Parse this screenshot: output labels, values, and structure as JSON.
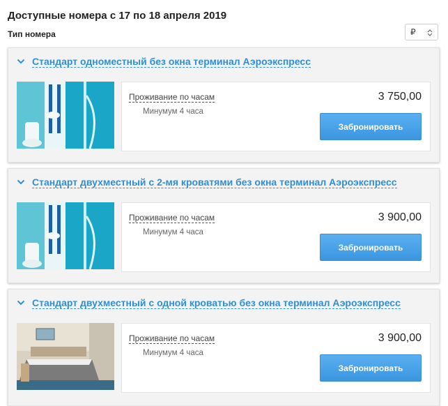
{
  "page_title": "Доступные номера с 17 по 18 апреля 2019",
  "room_type_label": "Тип номера",
  "currency": {
    "selected": "₽"
  },
  "rooms": [
    {
      "name": "Стандарт одноместный без окна терминал Аэроэкспресс",
      "tariff": "Проживание по часам",
      "minimum": "Минумум 4 часа",
      "price": "3 750,00",
      "book_label": "Забронировать"
    },
    {
      "name": "Стандарт двухместный с 2-мя кроватями без окна терминал Аэроэкспресс",
      "tariff": "Проживание по часам",
      "minimum": "Минумум 4 часа",
      "price": "3 900,00",
      "book_label": "Забронировать"
    },
    {
      "name": "Стандарт двухместный с одной кроватью без окна терминал Аэроэкспресс",
      "tariff": "Проживание по часам",
      "minimum": "Минумум 4 часа",
      "price": "3 900,00",
      "book_label": "Забронировать"
    }
  ],
  "colors": {
    "accent": "#2e8fd8",
    "button": "#3b96e0"
  }
}
